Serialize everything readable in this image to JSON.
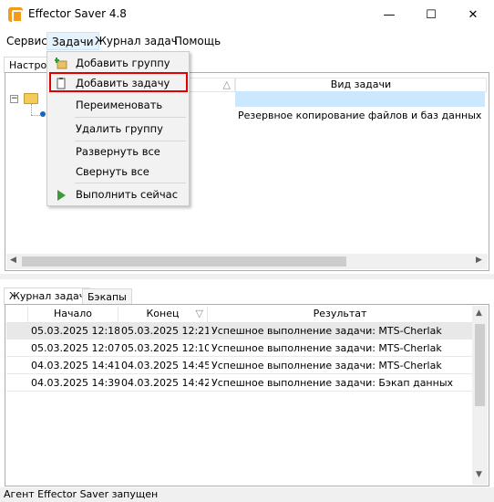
{
  "window": {
    "title": "Effector Saver 4.8",
    "controls": {
      "minimize": "—",
      "maximize": "☐",
      "close": "✕"
    }
  },
  "menubar": {
    "items": [
      "Сервис",
      "Задачи",
      "Журнал задач",
      "Помощь"
    ],
    "active": "Задачи"
  },
  "dropdown": {
    "items": [
      {
        "label": "Добавить группу",
        "icon": "add-folder-icon"
      },
      {
        "label": "Добавить задачу",
        "icon": "clipboard-icon",
        "highlighted": true
      },
      {
        "label": "Переименовать",
        "icon": ""
      },
      {
        "label": "Удалить группу",
        "icon": ""
      },
      {
        "label": "Развернуть все",
        "icon": ""
      },
      {
        "label": "Свернуть все",
        "icon": ""
      },
      {
        "label": "Выполнить сейчас",
        "icon": "play-icon"
      }
    ]
  },
  "top_tabs": {
    "settings_label": "Настрой"
  },
  "task_grid": {
    "columns": [
      "",
      "Вид задачи"
    ],
    "sort_indicator": "△",
    "rows": [
      {
        "type": ""
      },
      {
        "type": "Резервное копирование файлов и баз данных"
      }
    ]
  },
  "bottom_tabs": [
    "Журнал задач",
    "Бэкапы"
  ],
  "log_table": {
    "columns": [
      "Начало",
      "Конец",
      "Результат"
    ],
    "sort_indicator": "▽",
    "rows": [
      {
        "start": "05.03.2025 12:18:1",
        "end": "05.03.2025 12:21:2",
        "result": "Успешное выполнение задачи: MTS-Cherlak"
      },
      {
        "start": "05.03.2025 12:07:2",
        "end": "05.03.2025 12:10:4",
        "result": "Успешное выполнение задачи: MTS-Cherlak"
      },
      {
        "start": "04.03.2025 14:41:2",
        "end": "04.03.2025 14:45:1",
        "result": "Успешное выполнение задачи: MTS-Cherlak"
      },
      {
        "start": "04.03.2025 14:39:1",
        "end": "04.03.2025 14:42:5",
        "result": "Успешное выполнение задачи: Бэкап данных"
      }
    ]
  },
  "statusbar": {
    "text": "Агент Effector Saver запущен"
  },
  "colors": {
    "accent": "#f29a1a",
    "selection": "#cce8ff",
    "highlight_border": "#e00000",
    "play_green": "#3c9a3c"
  }
}
